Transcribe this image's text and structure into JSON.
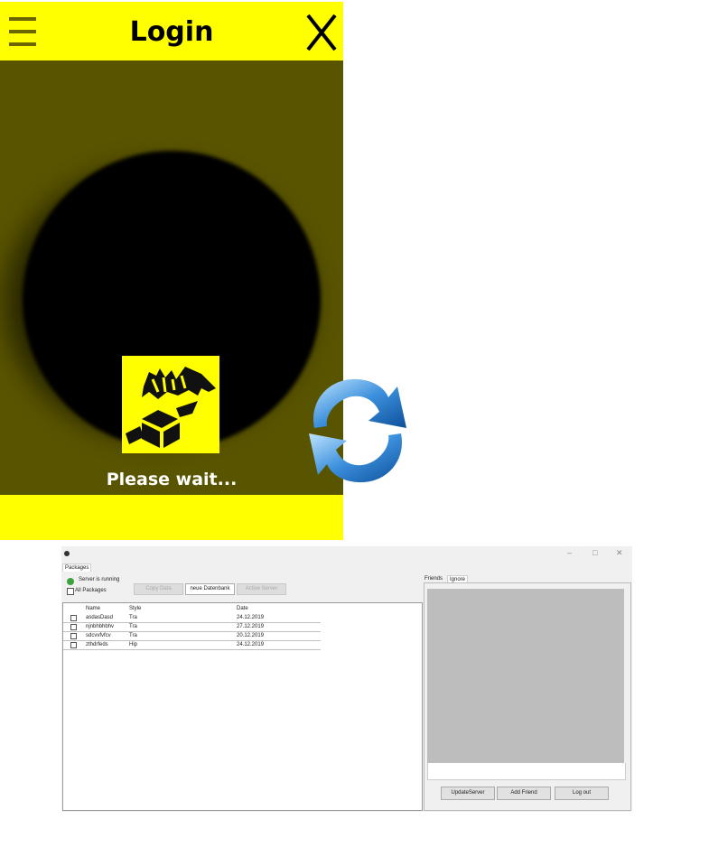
{
  "mobile": {
    "title": "Login",
    "status_text": "Please wait...",
    "logo_label": "MUP",
    "colors": {
      "accent": "#ffff00",
      "body": "#595400"
    },
    "icons": [
      "menu-icon",
      "close-icon",
      "refresh-icon"
    ]
  },
  "desktop": {
    "window_controls": {
      "minimize": "–",
      "maximize": "□",
      "close": "✕"
    },
    "tab_packages": "Packages",
    "server_status": "Server is running",
    "all_packages_label": "All Packages",
    "buttons": {
      "copy_data": "Copy Data",
      "neue_datenbank": "neue Datenbank",
      "active_server": "Active Server"
    },
    "table": {
      "columns": [
        "Name",
        "Style",
        "Date"
      ],
      "rows": [
        {
          "name": "asdasDasd",
          "style": "Tra",
          "date": "24.12.2019"
        },
        {
          "name": "njnbhbhbhv",
          "style": "Tra",
          "date": "27.12.2019"
        },
        {
          "name": "sdcvvfvfcv",
          "style": "Tra",
          "date": "20.12.2019"
        },
        {
          "name": "zthdrfeds",
          "style": "Hip",
          "date": "24.12.2019"
        }
      ]
    },
    "tabs_right": [
      "Friends",
      "Ignore"
    ],
    "bottom_buttons": {
      "update_server": "UpdateServer",
      "add_friend": "Add Friend",
      "log_out": "Log out"
    }
  }
}
